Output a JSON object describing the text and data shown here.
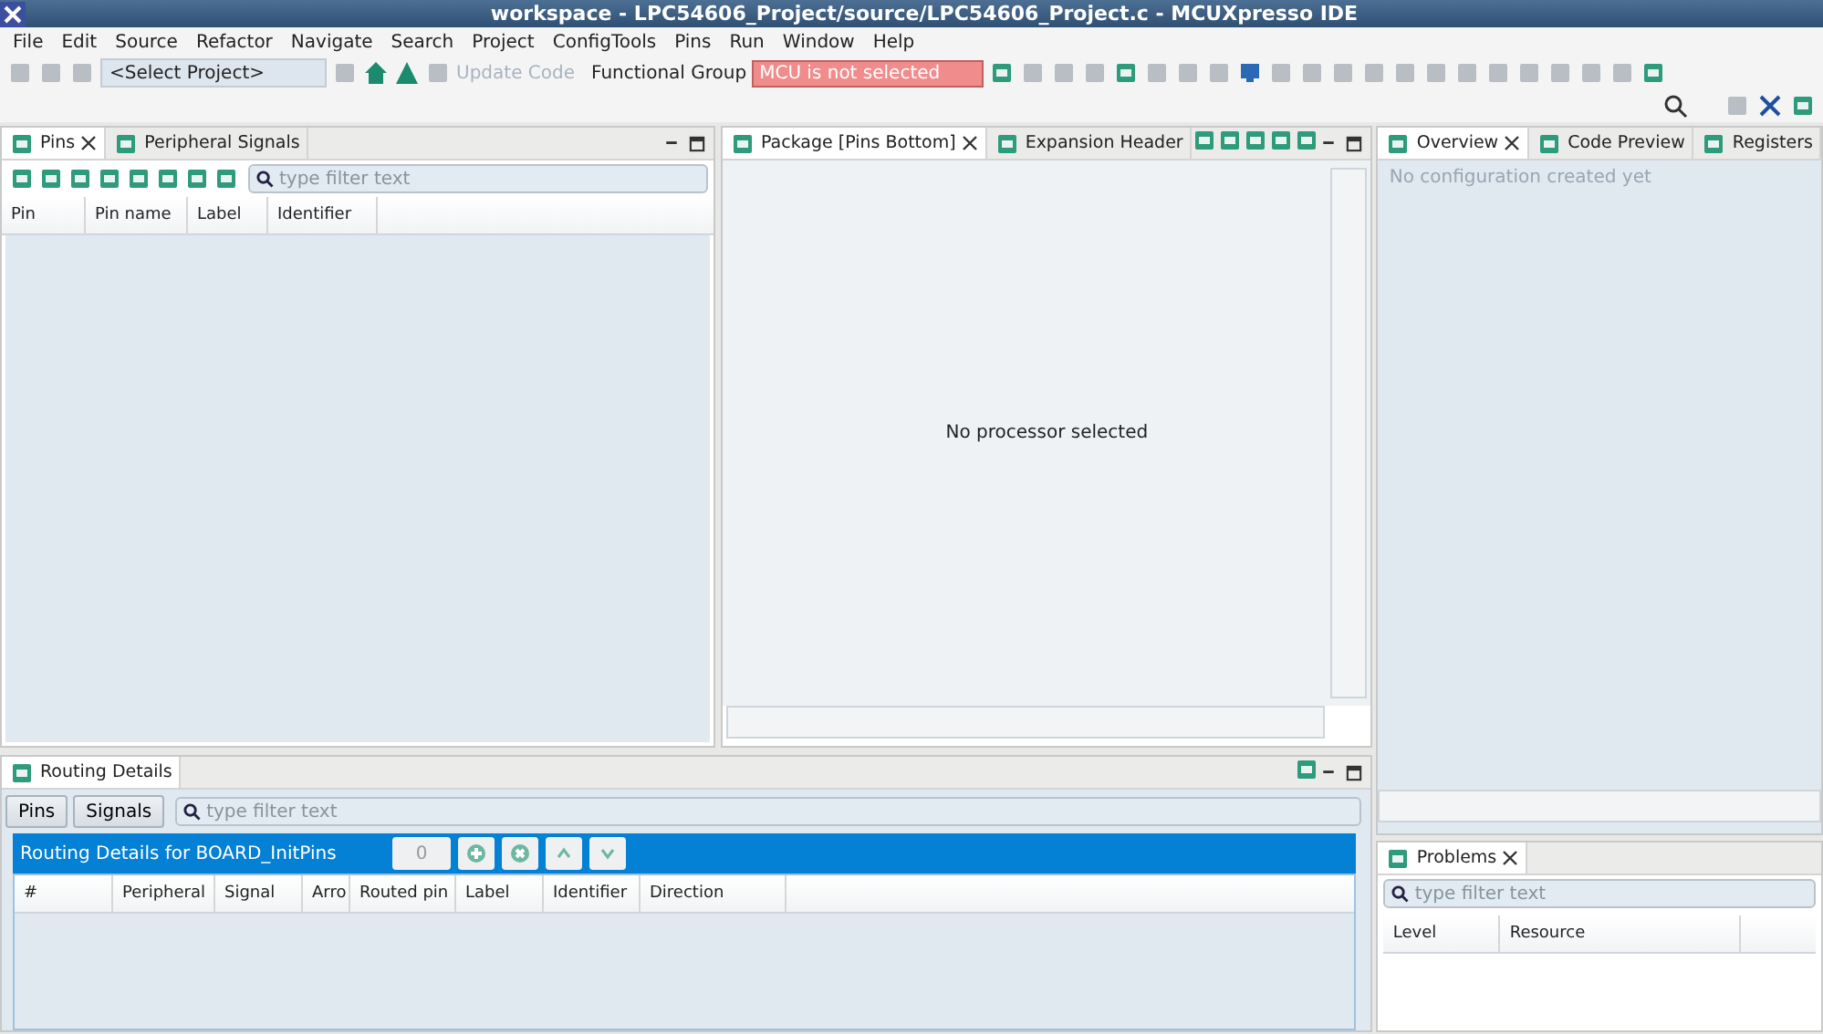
{
  "window": {
    "title": "workspace - LPC54606_Project/source/LPC54606_Project.c - MCUXpresso IDE"
  },
  "menu": [
    "File",
    "Edit",
    "Source",
    "Refactor",
    "Navigate",
    "Search",
    "Project",
    "ConfigTools",
    "Pins",
    "Run",
    "Window",
    "Help"
  ],
  "toolbar": {
    "project_selector": "<Select Project>",
    "update_code": {
      "label": "Update Code",
      "disabled": true
    },
    "functional_group_label": "Functional Group",
    "mcu_field": {
      "value": "MCU is not selected",
      "error": true
    }
  },
  "pins_panel": {
    "tabs": [
      {
        "label": "Pins",
        "selected": true,
        "closable": true
      },
      {
        "label": "Peripheral Signals",
        "selected": false,
        "closable": false
      }
    ],
    "filter": {
      "placeholder": "type filter text"
    },
    "columns": [
      "Pin",
      "Pin name",
      "Label",
      "Identifier"
    ]
  },
  "package_panel": {
    "tabs": [
      {
        "label": "Package [Pins Bottom]",
        "selected": true,
        "closable": true
      },
      {
        "label": "Expansion Header",
        "selected": false,
        "closable": false
      }
    ],
    "message": "No processor selected"
  },
  "overview_panel": {
    "tabs": [
      {
        "label": "Overview",
        "selected": true,
        "closable": true
      },
      {
        "label": "Code Preview",
        "selected": false,
        "closable": false
      },
      {
        "label": "Registers",
        "selected": false,
        "closable": false
      }
    ],
    "message": "No configuration created yet"
  },
  "routing_panel": {
    "title": "Routing Details",
    "buttons": [
      "Pins",
      "Signals"
    ],
    "filter": {
      "placeholder": "type filter text"
    },
    "header": "Routing Details for BOARD_InitPins",
    "count": "0",
    "columns": [
      "#",
      "Peripheral",
      "Signal",
      "Arro",
      "Routed pin",
      "Label",
      "Identifier",
      "Direction"
    ]
  },
  "problems_panel": {
    "tabs": [
      {
        "label": "Problems",
        "selected": true,
        "closable": true
      }
    ],
    "filter": {
      "placeholder": "type filter text"
    },
    "columns": [
      "Level",
      "Resource"
    ]
  }
}
